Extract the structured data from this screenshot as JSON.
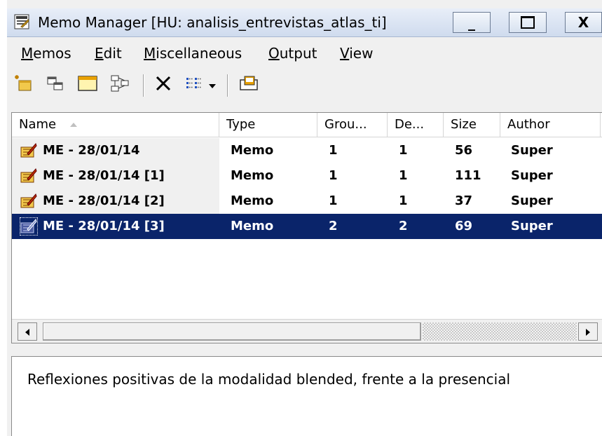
{
  "window": {
    "title": "Memo Manager [HU: analisis_entrevistas_atlas_ti]",
    "minimize_label": "_",
    "close_label": "X"
  },
  "menu": [
    {
      "label": "Memos",
      "accel": "M",
      "rest": "emos"
    },
    {
      "label": "Edit",
      "accel": "E",
      "rest": "dit"
    },
    {
      "label": "Miscellaneous",
      "accel": "M",
      "rest": "iscellaneous"
    },
    {
      "label": "Output",
      "accel": "O",
      "rest": "utput"
    },
    {
      "label": "View",
      "accel": "V",
      "rest": "iew"
    }
  ],
  "toolbar": {
    "icons": [
      "new-memo-icon",
      "duplicate-memo-icon",
      "window-icon",
      "network-icon",
      "delete-icon",
      "list-view-icon",
      "dropdown-arrow-icon",
      "copy-to-clipboard-icon"
    ]
  },
  "table": {
    "columns": [
      "Name",
      "Type",
      "Grou...",
      "De...",
      "Size",
      "Author"
    ],
    "sort_column": "Name",
    "sort_direction": "ascending",
    "rows": [
      {
        "name": "ME - 28/01/14",
        "type": "Memo",
        "groups": "1",
        "density": "1",
        "size": "56",
        "author": "Super"
      },
      {
        "name": "ME - 28/01/14 [1]",
        "type": "Memo",
        "groups": "1",
        "density": "1",
        "size": "111",
        "author": "Super"
      },
      {
        "name": "ME - 28/01/14 [2]",
        "type": "Memo",
        "groups": "1",
        "density": "1",
        "size": "37",
        "author": "Super"
      },
      {
        "name": "ME - 28/01/14 [3]",
        "type": "Memo",
        "groups": "2",
        "density": "2",
        "size": "69",
        "author": "Super"
      }
    ],
    "selected_index": 3
  },
  "description": "Reflexiones positivas de la modalidad blended, frente a la presencial",
  "colors": {
    "selection": "#0a246a",
    "titlebar": "#dbe5f4"
  }
}
